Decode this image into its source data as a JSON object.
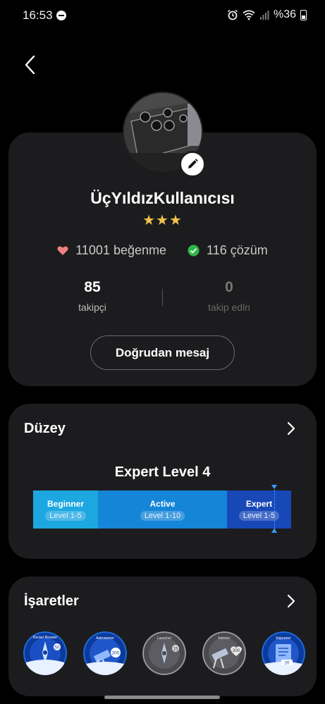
{
  "status_bar": {
    "time": "16:53",
    "battery_text": "%36"
  },
  "profile": {
    "username": "ÜçYıldızKullanıcısı",
    "stars": "★★★",
    "likes_count": "11001",
    "likes_label": "beğenme",
    "solutions_count": "116",
    "solutions_label": "çözüm",
    "followers_count": "85",
    "followers_label": "takipçi",
    "following_count": "0",
    "following_label": "takip edln",
    "dm_button": "Doğrudan mesaj"
  },
  "level": {
    "title": "Düzey",
    "current": "Expert Level 4",
    "segments": [
      {
        "name": "Beginner",
        "range": "Level 1-5"
      },
      {
        "name": "Active",
        "range": "Level 1-10"
      },
      {
        "name": "Expert",
        "range": "Level 1-5"
      }
    ]
  },
  "badges": {
    "title": "İşaretler",
    "items": [
      {
        "name": "Rocket Booster",
        "count": "50"
      },
      {
        "name": "Astronomer",
        "count": "200"
      },
      {
        "name": "Launcher",
        "count": "15"
      },
      {
        "name": "Admirer",
        "count": "300"
      },
      {
        "name": "Sojourner",
        "count": "20"
      }
    ]
  },
  "colors": {
    "background": "#000000",
    "card": "#1c1c1e",
    "star": "#f0c34a",
    "heart": "#f08080",
    "check": "#2fb84a",
    "beginner": "#1da7e0",
    "active": "#1585d8",
    "expert": "#1847b8"
  }
}
